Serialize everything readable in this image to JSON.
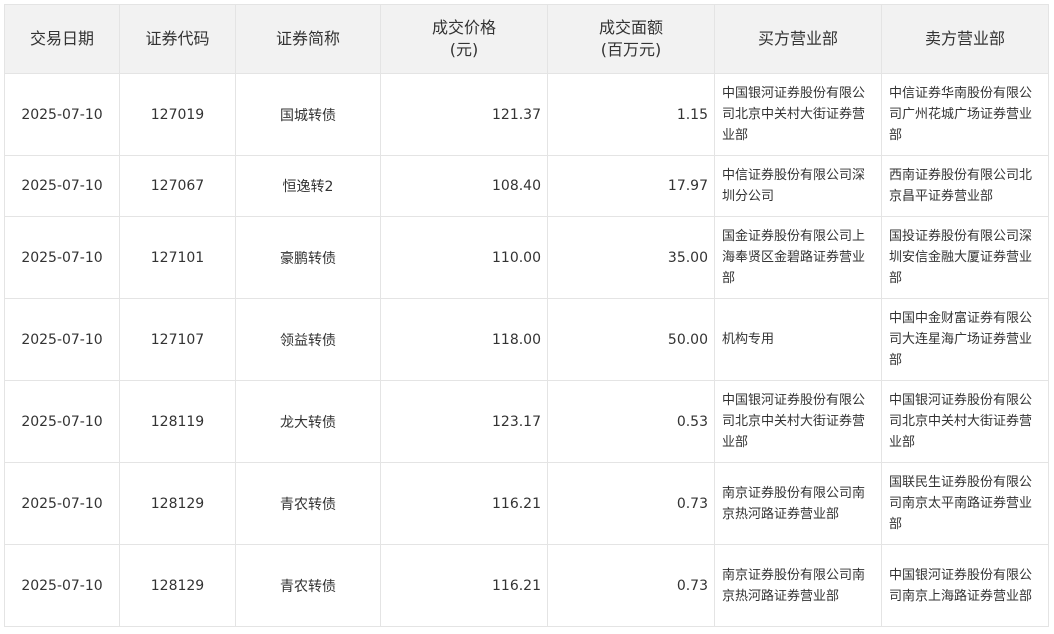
{
  "table": {
    "headers": {
      "date": "交易日期",
      "code": "证券代码",
      "name": "证券简称",
      "price_line1": "成交价格",
      "price_line2": "(元)",
      "amount_line1": "成交面额",
      "amount_line2": "(百万元)",
      "buyer": "买方营业部",
      "seller": "卖方营业部"
    },
    "rows": [
      {
        "date": "2025-07-10",
        "code": "127019",
        "name": "国城转债",
        "price": "121.37",
        "amount": "1.15",
        "buyer": "中国银河证券股份有限公司北京中关村大街证券营业部",
        "seller": "中信证券华南股份有限公司广州花城广场证券营业部"
      },
      {
        "date": "2025-07-10",
        "code": "127067",
        "name": "恒逸转2",
        "price": "108.40",
        "amount": "17.97",
        "buyer": "中信证券股份有限公司深圳分公司",
        "seller": "西南证券股份有限公司北京昌平证券营业部"
      },
      {
        "date": "2025-07-10",
        "code": "127101",
        "name": "豪鹏转债",
        "price": "110.00",
        "amount": "35.00",
        "buyer": "国金证券股份有限公司上海奉贤区金碧路证券营业部",
        "seller": "国投证券股份有限公司深圳安信金融大厦证券营业部"
      },
      {
        "date": "2025-07-10",
        "code": "127107",
        "name": "领益转债",
        "price": "118.00",
        "amount": "50.00",
        "buyer": "机构专用",
        "seller": "中国中金财富证券有限公司大连星海广场证券营业部"
      },
      {
        "date": "2025-07-10",
        "code": "128119",
        "name": "龙大转债",
        "price": "123.17",
        "amount": "0.53",
        "buyer": "中国银河证券股份有限公司北京中关村大街证券营业部",
        "seller": "中国银河证券股份有限公司北京中关村大街证券营业部"
      },
      {
        "date": "2025-07-10",
        "code": "128129",
        "name": "青农转债",
        "price": "116.21",
        "amount": "0.73",
        "buyer": "南京证券股份有限公司南京热河路证券营业部",
        "seller": "国联民生证券股份有限公司南京太平南路证券营业部"
      },
      {
        "date": "2025-07-10",
        "code": "128129",
        "name": "青农转债",
        "price": "116.21",
        "amount": "0.73",
        "buyer": "南京证券股份有限公司南京热河路证券营业部",
        "seller": "中国银河证券股份有限公司南京上海路证券营业部"
      }
    ]
  }
}
